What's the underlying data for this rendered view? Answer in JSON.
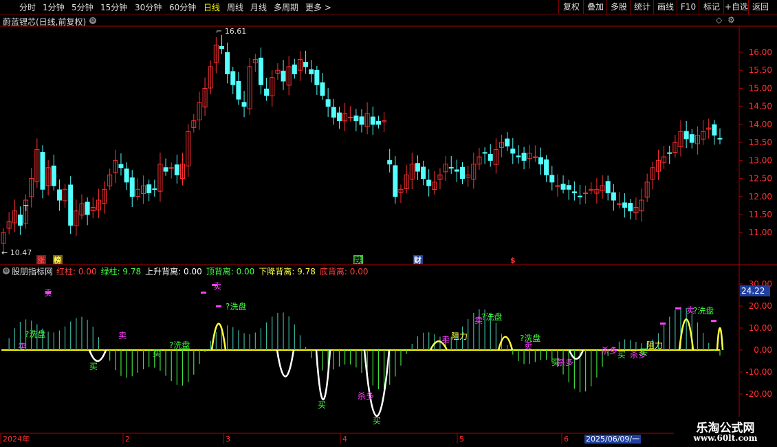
{
  "toolbar": {
    "periods": [
      {
        "label": "分时"
      },
      {
        "label": "1分钟"
      },
      {
        "label": "5分钟"
      },
      {
        "label": "15分钟"
      },
      {
        "label": "30分钟"
      },
      {
        "label": "60分钟"
      },
      {
        "label": "日线",
        "active": true
      },
      {
        "label": "周线"
      },
      {
        "label": "月线"
      },
      {
        "label": "多周期"
      },
      {
        "label": "更多 >"
      }
    ],
    "buttons": [
      {
        "label": "复权"
      },
      {
        "label": "叠加"
      },
      {
        "label": "多股"
      },
      {
        "label": "统计"
      },
      {
        "label": "画线"
      },
      {
        "label": "F10"
      },
      {
        "label": "标记"
      },
      {
        "label": "+自选"
      },
      {
        "label": "返回"
      }
    ]
  },
  "main_chart": {
    "title": "蔚蓝锂芯(日线,前复权)",
    "high_label": "16.61",
    "low_label": "10.47",
    "t_marker": "T",
    "yticks": [
      "16.00",
      "15.50",
      "15.00",
      "14.50",
      "14.00",
      "13.50",
      "13.00",
      "12.50",
      "12.00",
      "11.50",
      "11.00"
    ],
    "events": [
      {
        "label": "涨",
        "color": "#ff4040",
        "bg": "#802020"
      },
      {
        "label": "榜",
        "color": "#ffff40",
        "bg": "#806020"
      },
      {
        "label": "跌",
        "color": "#000000",
        "bg": "#40c040"
      },
      {
        "label": "财",
        "color": "#ffffff",
        "bg": "#2040a0"
      },
      {
        "label": "$",
        "color": "#ff3030",
        "bg": ""
      }
    ]
  },
  "indicator": {
    "name": "股朋指标网",
    "values": [
      {
        "label": "红柱:",
        "value": "0.00",
        "color": "#ff4040"
      },
      {
        "label": "绿柱:",
        "value": "9.78",
        "color": "#40ff40"
      },
      {
        "label": "上升背离:",
        "value": "0.00",
        "color": "#ffffff"
      },
      {
        "label": "顶背离:",
        "value": "0.00",
        "color": "#40ff40"
      },
      {
        "label": "下降背离:",
        "value": "9.78",
        "color": "#ffff40"
      },
      {
        "label": "底背离:",
        "value": "0.00",
        "color": "#ff4040"
      }
    ],
    "yticks": [
      "30.00",
      "20.00",
      "10.00",
      "0.00",
      "-10.00",
      "-20.00"
    ],
    "current_value": "24.22",
    "signals": {
      "sell": "卖",
      "wash": "?洗盘",
      "buy": "买",
      "long": "杀多",
      "resist": "阻力"
    }
  },
  "timeline": {
    "labels": [
      "2024年",
      "2",
      "3",
      "4",
      "5",
      "6"
    ],
    "cursor_date": "2025/06/09/一"
  },
  "watermark": {
    "line1": "乐淘公式网",
    "line2": "www.60lt.com"
  },
  "colors": {
    "up": "#ff3030",
    "down": "#54ffff",
    "axis": "#b00000",
    "grid_text": "#ff3030"
  }
}
